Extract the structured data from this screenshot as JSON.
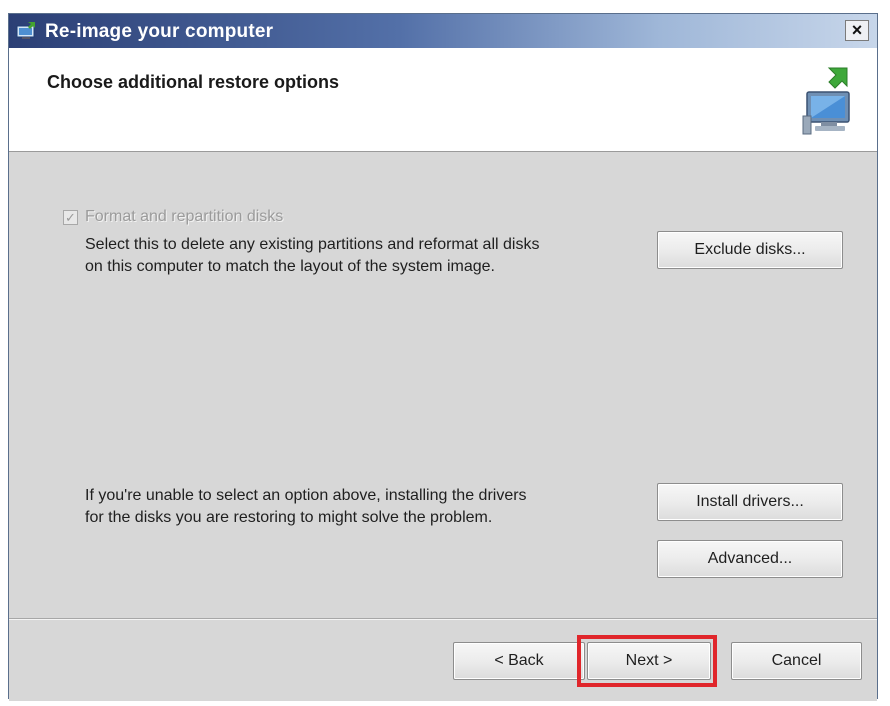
{
  "window": {
    "title": "Re-image your computer",
    "close_label": "×"
  },
  "header": {
    "title": "Choose additional restore options"
  },
  "format_option": {
    "checked": true,
    "disabled": true,
    "label": "Format and repartition disks",
    "description_line1": "Select this to delete any existing partitions and reformat all disks",
    "description_line2": "on this computer to match the layout of the system image."
  },
  "drivers_note": {
    "line1": "If you're unable to select an option above, installing the drivers",
    "line2": "for the disks you are restoring to might solve the problem."
  },
  "buttons": {
    "exclude_disks": "Exclude disks...",
    "install_drivers": "Install drivers...",
    "advanced": "Advanced...",
    "back": "< Back",
    "next": "Next >",
    "cancel": "Cancel"
  },
  "highlight": {
    "target": "next-button",
    "color": "#e0262b"
  },
  "icons": {
    "title_icon": "reimage-computer-icon",
    "header_icon": "computer-restore-icon",
    "checkbox_mark": "✓"
  }
}
